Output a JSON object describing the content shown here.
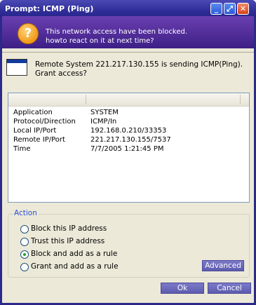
{
  "window": {
    "title": "Prompt: ICMP (Ping)"
  },
  "banner": {
    "line1": "This network access have been blocked.",
    "line2": "howto react on it at next time?",
    "icon": "question-icon"
  },
  "question": "Remote System 221.217.130.155 is sending ICMP(Ping). Grant access?",
  "details": {
    "rows": [
      {
        "key": "Application",
        "value": "SYSTEM"
      },
      {
        "key": "Protocol/Direction",
        "value": "ICMP/In"
      },
      {
        "key": "Local IP/Port",
        "value": "192.168.0.210/33353"
      },
      {
        "key": "Remote IP/Port",
        "value": "221.217.130.155/7537"
      },
      {
        "key": "Time",
        "value": "7/7/2005 1:21:45 PM"
      }
    ]
  },
  "action": {
    "legend": "Action",
    "options": [
      {
        "label": "Block this IP address",
        "selected": false
      },
      {
        "label": "Trust this IP address",
        "selected": false
      },
      {
        "label": "Block and add as a rule",
        "selected": true
      },
      {
        "label": "Grant and add as a rule",
        "selected": false
      }
    ],
    "advanced_label": "Advanced"
  },
  "buttons": {
    "ok": "Ok",
    "cancel": "Cancel"
  },
  "colors": {
    "title_bar": "#2f2d98",
    "banner": "#5a33a6",
    "button": "#6c6abb",
    "legend": "#2b4fd8"
  }
}
